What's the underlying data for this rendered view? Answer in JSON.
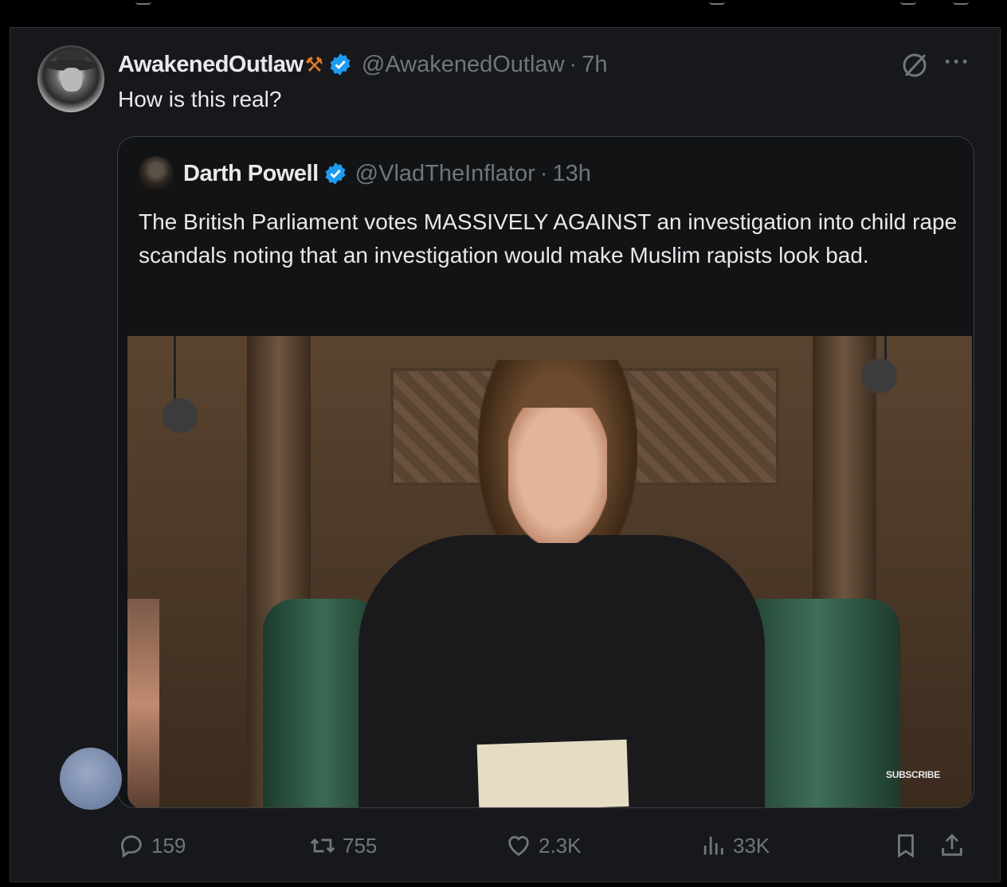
{
  "post": {
    "author_name": "AwakenedOutlaw",
    "author_emoji": "⚒",
    "author_handle": "@AwakenedOutlaw",
    "separator": "·",
    "time": "7h",
    "text": "How is this real?",
    "more_label": "···"
  },
  "quote": {
    "author_name": "Darth Powell",
    "author_handle": "@VladTheInflator",
    "separator": "·",
    "time": "13h",
    "text": "The British Parliament votes MASSIVELY AGAINST an investigation into child rape scandals noting that an investigation would make Muslim rapists look bad.",
    "media_overlay": "SUBSCRIBE"
  },
  "actions": {
    "replies": "159",
    "reposts": "755",
    "likes": "2.3K",
    "views": "33K"
  },
  "colors": {
    "verified": "#1d9bf0",
    "muted": "#71767b",
    "text": "#e7e9ea"
  },
  "icons": [
    "grok-icon",
    "more-icon",
    "verified-badge-icon",
    "reply-icon",
    "repost-icon",
    "like-icon",
    "views-icon",
    "bookmark-icon",
    "share-icon"
  ]
}
